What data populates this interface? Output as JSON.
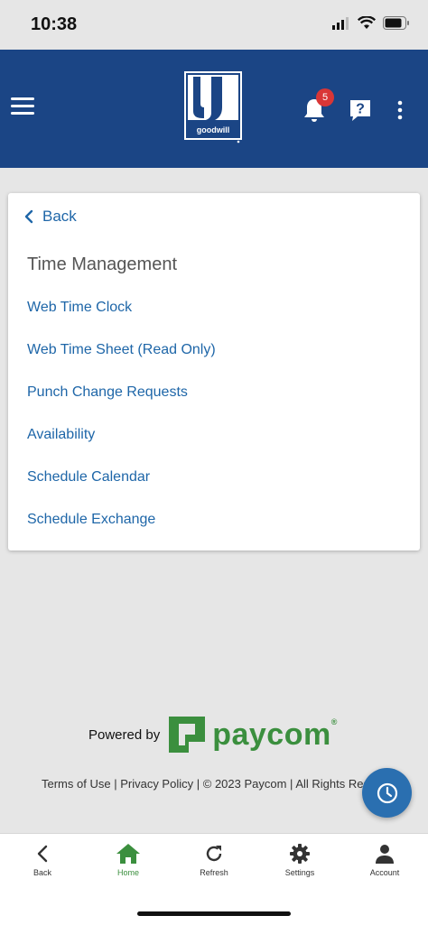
{
  "status_bar": {
    "time": "10:38",
    "icons": [
      "signal-icon",
      "wifi-icon",
      "battery-icon"
    ]
  },
  "header": {
    "menu_icon": "hamburger-menu-icon",
    "logo_text": "goodwill",
    "notifications_icon": "bell-icon",
    "notification_count": "5",
    "help_icon": "question-icon",
    "more_icon": "more-vertical-icon",
    "colors": {
      "background": "#1b4585",
      "badge": "#d93636"
    }
  },
  "card": {
    "back_label": "Back",
    "title": "Time Management",
    "items": [
      {
        "label": "Web Time Clock"
      },
      {
        "label": "Web Time Sheet (Read Only)"
      },
      {
        "label": "Punch Change Requests"
      },
      {
        "label": "Availability"
      },
      {
        "label": "Schedule Calendar"
      },
      {
        "label": "Schedule Exchange"
      }
    ],
    "link_color": "#1e66a8"
  },
  "footer": {
    "powered_by": "Powered by",
    "brand": "paycom",
    "brand_mark": "®",
    "terms": "Terms of Use",
    "privacy": "Privacy Policy",
    "copyright": "© 2023 Paycom | All Rights Reserved",
    "brand_color": "#3b8f3e"
  },
  "fab": {
    "icon": "clock-icon",
    "color": "#2a6fb0"
  },
  "tabbar": {
    "tabs": [
      {
        "label": "Back",
        "icon": "chevron-left-icon"
      },
      {
        "label": "Home",
        "icon": "home-icon",
        "active": true
      },
      {
        "label": "Refresh",
        "icon": "refresh-icon"
      },
      {
        "label": "Settings",
        "icon": "gear-icon"
      },
      {
        "label": "Account",
        "icon": "person-icon"
      }
    ]
  }
}
